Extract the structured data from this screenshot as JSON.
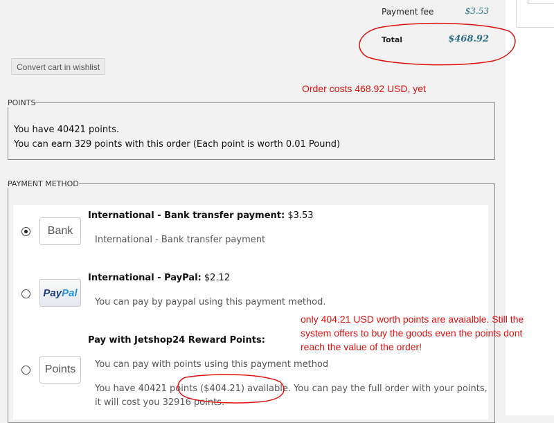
{
  "summary": {
    "payment_fee_label": "Payment fee",
    "payment_fee_value": "$3.53",
    "total_label": "Total",
    "total_value": "$468.92"
  },
  "toolbar": {
    "convert_button": "Convert cart in wishlist"
  },
  "annotations": {
    "order_cost_note": "Order costs 468.92 USD, yet",
    "points_note": "only 404.21 USD worth points are avaialble. Still the system offers to buy the goods even the points dont reach the value of the order!"
  },
  "points_section": {
    "legend": "POINTS",
    "line1": "You have 40421 points.",
    "line2": "You can earn 329 points with this order (Each point is worth 0.01 Pound)"
  },
  "payment_section": {
    "legend": "PAYMENT METHOD",
    "methods": [
      {
        "logo_text": "Bank",
        "name": "International - Bank transfer payment:",
        "price": "$3.53",
        "description": "International - Bank transfer payment",
        "selected": true
      },
      {
        "logo_text": "PayPal",
        "logo_part1": "Pay",
        "logo_part2": "Pal",
        "name": "International - PayPal:",
        "price": "$2.12",
        "description": "You can pay by paypal using this payment method.",
        "selected": false
      },
      {
        "logo_text": "Points",
        "name": "Pay with Jetshop24 Reward Points:",
        "price": "",
        "description": "You can pay with points using this payment method",
        "extra": "You have 40421 points ($404.21) available. You can pay the full order with your points, it will cost you 32916 points.",
        "selected": false
      }
    ]
  },
  "colors": {
    "annotation": "#e01010",
    "price_teal": "#2a6f86"
  }
}
